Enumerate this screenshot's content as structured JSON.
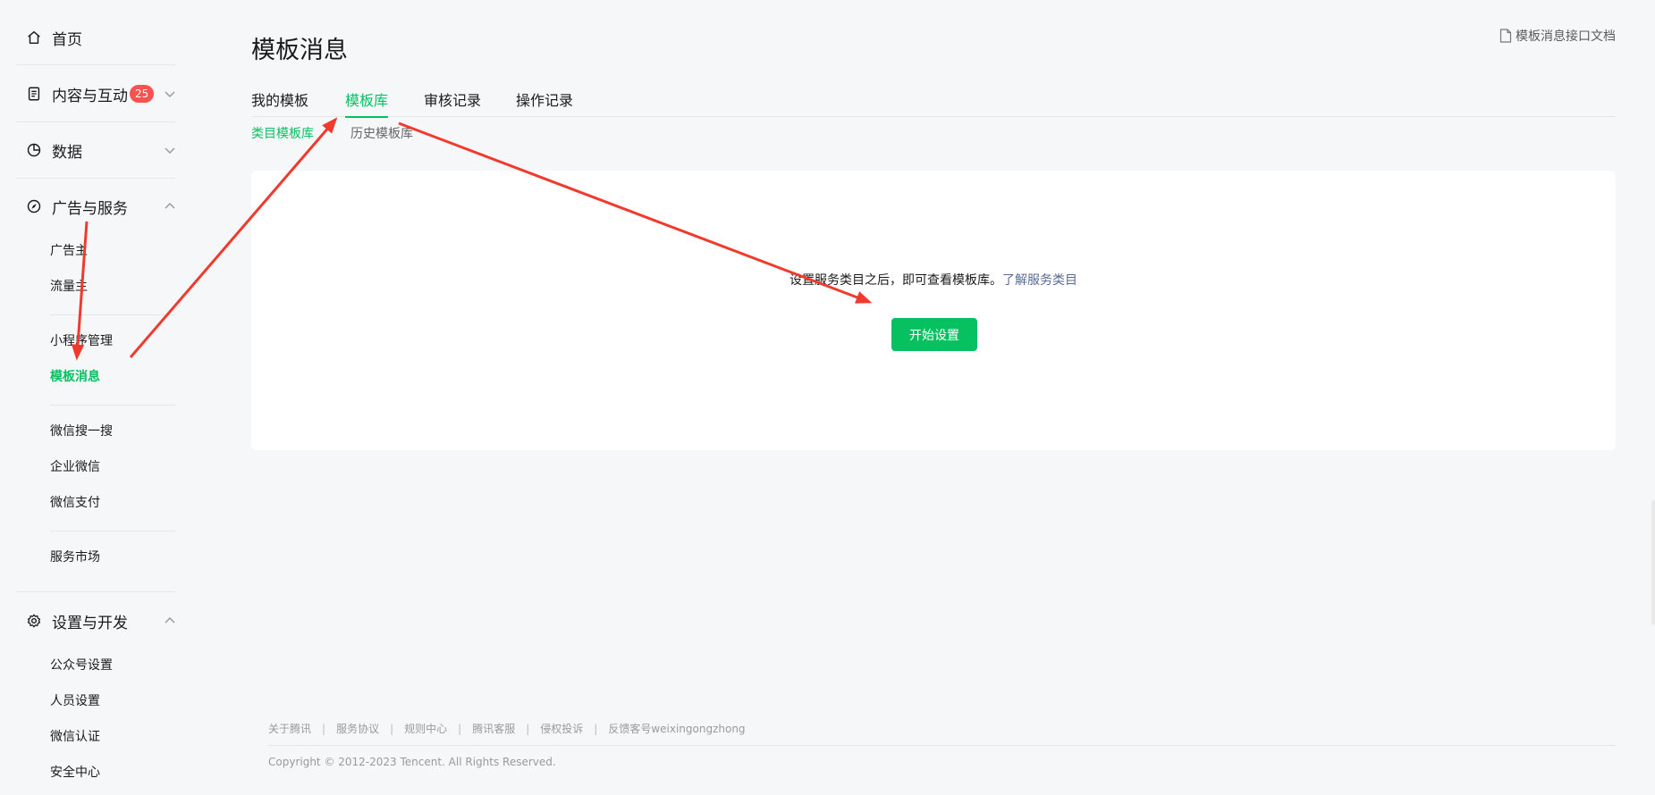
{
  "sidebar": {
    "home": "首页",
    "content": "内容与互动",
    "content_badge": "25",
    "data": "数据",
    "ads": "广告与服务",
    "ads_items": [
      "广告主",
      "流量主",
      "小程序管理",
      "模板消息",
      "微信搜一搜",
      "企业微信",
      "微信支付",
      "服务市场"
    ],
    "settings": "设置与开发",
    "settings_items": [
      "公众号设置",
      "人员设置",
      "微信认证",
      "安全中心"
    ]
  },
  "main": {
    "title": "模板消息",
    "doc_link": "模板消息接口文档",
    "tabs": [
      "我的模板",
      "模板库",
      "审核记录",
      "操作记录"
    ],
    "active_tab": "模板库",
    "subtabs": [
      "类目模板库",
      "历史模板库"
    ],
    "active_subtab": "类目模板库",
    "empty_text": "设置服务类目之后，即可查看模板库。",
    "empty_link": "了解服务类目",
    "start_button": "开始设置"
  },
  "footer": {
    "links": [
      "关于腾讯",
      "服务协议",
      "规则中心",
      "腾讯客服",
      "侵权投诉",
      "反馈客号weixingongzhong"
    ],
    "copyright": "Copyright © 2012-2023 Tencent. All Rights Reserved."
  },
  "colors": {
    "accent": "#07c160",
    "badge": "#fa5151",
    "link": "#576b95",
    "annotation": "#f03a2e"
  }
}
